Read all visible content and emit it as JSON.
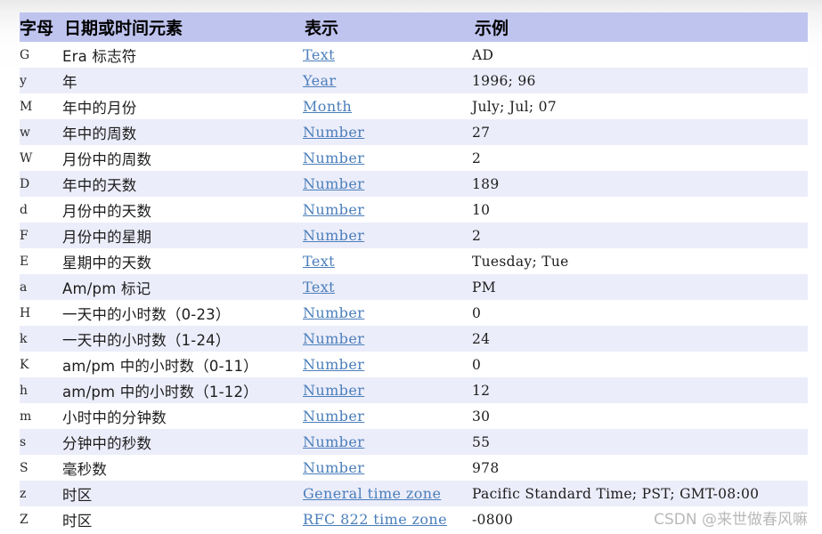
{
  "table": {
    "headers": [
      {
        "key": "letter",
        "label": "字母"
      },
      {
        "key": "element",
        "label": "日期或时间元素"
      },
      {
        "key": "present",
        "label": "表示"
      },
      {
        "key": "example",
        "label": "示例"
      }
    ],
    "rows": [
      {
        "letter": "G",
        "element": "Era 标志符",
        "present": "Text",
        "example": "AD"
      },
      {
        "letter": "y",
        "element": "年",
        "present": "Year",
        "example": "1996; 96"
      },
      {
        "letter": "M",
        "element": "年中的月份",
        "present": "Month",
        "example": "July; Jul; 07"
      },
      {
        "letter": "w",
        "element": "年中的周数",
        "present": "Number",
        "example": "27"
      },
      {
        "letter": "W",
        "element": "月份中的周数",
        "present": "Number",
        "example": "2"
      },
      {
        "letter": "D",
        "element": "年中的天数",
        "present": "Number",
        "example": "189"
      },
      {
        "letter": "d",
        "element": "月份中的天数",
        "present": "Number",
        "example": "10"
      },
      {
        "letter": "F",
        "element": "月份中的星期",
        "present": "Number",
        "example": "2"
      },
      {
        "letter": "E",
        "element": "星期中的天数",
        "present": "Text",
        "example": "Tuesday; Tue"
      },
      {
        "letter": "a",
        "element": "Am/pm 标记",
        "present": "Text",
        "example": "PM"
      },
      {
        "letter": "H",
        "element": "一天中的小时数（0-23）",
        "present": "Number",
        "example": "0"
      },
      {
        "letter": "k",
        "element": "一天中的小时数（1-24）",
        "present": "Number",
        "example": "24"
      },
      {
        "letter": "K",
        "element": "am/pm 中的小时数（0-11）",
        "present": "Number",
        "example": "0"
      },
      {
        "letter": "h",
        "element": "am/pm 中的小时数（1-12）",
        "present": "Number",
        "example": "12"
      },
      {
        "letter": "m",
        "element": "小时中的分钟数",
        "present": "Number",
        "example": "30"
      },
      {
        "letter": "s",
        "element": "分钟中的秒数",
        "present": "Number",
        "example": "55"
      },
      {
        "letter": "S",
        "element": "毫秒数",
        "present": "Number",
        "example": "978"
      },
      {
        "letter": "z",
        "element": "时区",
        "present": "General time zone",
        "example": "Pacific Standard Time; PST; GMT-08:00"
      },
      {
        "letter": "Z",
        "element": "时区",
        "present": "RFC 822 time zone",
        "example": "-0800"
      }
    ]
  },
  "watermark": {
    "text": "CSDN @来世做春风嘛"
  },
  "colors": {
    "header_background": "#bfc4ef",
    "row_alt_background": "#ecedfa",
    "row_background": "#ffffff",
    "link": "#4a7ebb",
    "text": "#1d1d1d",
    "watermark": "#b9b9b9"
  }
}
